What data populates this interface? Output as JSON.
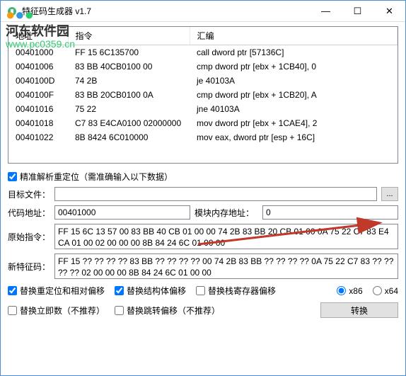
{
  "titlebar": {
    "title": "特征码生成器 v1.7"
  },
  "watermark": {
    "site": "河东软件园",
    "url": "www.pc0359.cn"
  },
  "table": {
    "headers": [
      "地址",
      "指令",
      "汇编"
    ],
    "rows": [
      {
        "addr": "00401000",
        "inst": "FF 15 6C135700",
        "asm": "call dword ptr [57136C]"
      },
      {
        "addr": "00401006",
        "inst": "83 BB 40CB0100 00",
        "asm": "cmp dword ptr [ebx + 1CB40], 0"
      },
      {
        "addr": "0040100D",
        "inst": "74 2B",
        "asm": "je 40103A"
      },
      {
        "addr": "0040100F",
        "inst": "83 BB 20CB0100 0A",
        "asm": "cmp dword ptr [ebx + 1CB20], A"
      },
      {
        "addr": "00401016",
        "inst": "75 22",
        "asm": "jne 40103A"
      },
      {
        "addr": "00401018",
        "inst": "C7 83 E4CA0100 02000000",
        "asm": "mov dword ptr [ebx + 1CAE4], 2"
      },
      {
        "addr": "00401022",
        "inst": "8B 8424 6C010000",
        "asm": "mov eax, dword ptr [esp + 16C]"
      }
    ]
  },
  "precise": {
    "label": "精准解析重定位（需准确输入以下数据）"
  },
  "target": {
    "label": "目标文件：",
    "value": ""
  },
  "code_addr": {
    "label": "代码地址：",
    "value": "00401000"
  },
  "mod_addr": {
    "label": "模块内存地址：",
    "value": "0"
  },
  "orig_inst": {
    "label": "原始指令：",
    "value": "FF 15 6C 13 57 00 83 BB 40 CB 01 00 00 74 2B 83 BB 20 CB 01 00 0A 75 22 C7 83 E4 CA 01 00 02 00 00 00 8B 84 24 6C 01 00 00"
  },
  "new_sig": {
    "label": "新特征码：",
    "value": "FF 15 ?? ?? ?? ?? 83 BB ?? ?? ?? ?? 00 74 2B 83 BB ?? ?? ?? ?? 0A 75 22 C7 83 ?? ?? ?? ?? 02 00 00 00 8B 84 24 6C 01 00 00"
  },
  "checks": {
    "reloc_rel": "替换重定位和相对偏移",
    "struct_off": "替换结构体偏移",
    "stack_off": "替换栈寄存器偏移",
    "replace_imm": "替换立即数（不推荐）",
    "replace_jmp": "替换跳转偏移（不推荐）",
    "x86": "x86",
    "x64": "x64"
  },
  "convert": "转换"
}
